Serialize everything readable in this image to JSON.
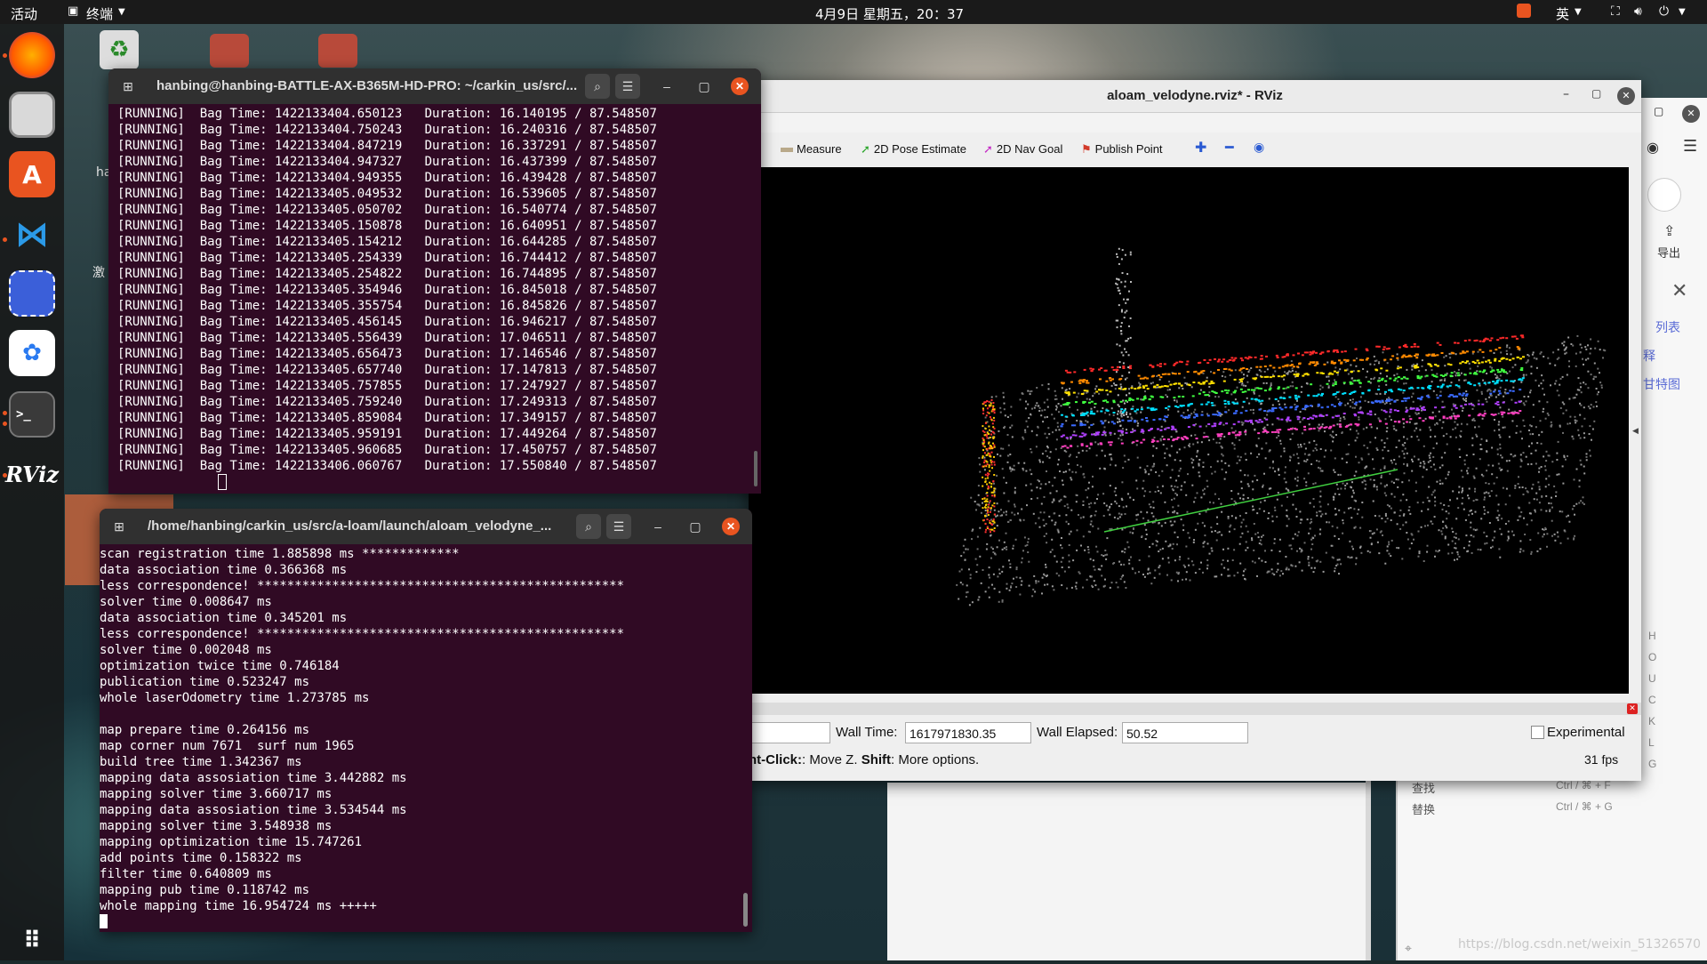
{
  "topbar": {
    "activities": "活动",
    "app_menu": "终端",
    "clock": "4月9日 星期五，20：37",
    "input_method": "英"
  },
  "desktop": {
    "icon_labels": [
      "ha",
      "激"
    ]
  },
  "terminal1": {
    "title": "hanbing@hanbing-BATTLE-AX-B365M-HD-PRO: ~/carkin_us/src/...",
    "lines": [
      "[RUNNING]  Bag Time: 1422133404.650123   Duration: 16.140195 / 87.548507",
      "[RUNNING]  Bag Time: 1422133404.750243   Duration: 16.240316 / 87.548507",
      "[RUNNING]  Bag Time: 1422133404.847219   Duration: 16.337291 / 87.548507",
      "[RUNNING]  Bag Time: 1422133404.947327   Duration: 16.437399 / 87.548507",
      "[RUNNING]  Bag Time: 1422133404.949355   Duration: 16.439428 / 87.548507",
      "[RUNNING]  Bag Time: 1422133405.049532   Duration: 16.539605 / 87.548507",
      "[RUNNING]  Bag Time: 1422133405.050702   Duration: 16.540774 / 87.548507",
      "[RUNNING]  Bag Time: 1422133405.150878   Duration: 16.640951 / 87.548507",
      "[RUNNING]  Bag Time: 1422133405.154212   Duration: 16.644285 / 87.548507",
      "[RUNNING]  Bag Time: 1422133405.254339   Duration: 16.744412 / 87.548507",
      "[RUNNING]  Bag Time: 1422133405.254822   Duration: 16.744895 / 87.548507",
      "[RUNNING]  Bag Time: 1422133405.354946   Duration: 16.845018 / 87.548507",
      "[RUNNING]  Bag Time: 1422133405.355754   Duration: 16.845826 / 87.548507",
      "[RUNNING]  Bag Time: 1422133405.456145   Duration: 16.946217 / 87.548507",
      "[RUNNING]  Bag Time: 1422133405.556439   Duration: 17.046511 / 87.548507",
      "[RUNNING]  Bag Time: 1422133405.656473   Duration: 17.146546 / 87.548507",
      "[RUNNING]  Bag Time: 1422133405.657740   Duration: 17.147813 / 87.548507",
      "[RUNNING]  Bag Time: 1422133405.757855   Duration: 17.247927 / 87.548507",
      "[RUNNING]  Bag Time: 1422133405.759240   Duration: 17.249313 / 87.548507",
      "[RUNNING]  Bag Time: 1422133405.859084   Duration: 17.349157 / 87.548507",
      "[RUNNING]  Bag Time: 1422133405.959191   Duration: 17.449264 / 87.548507",
      "[RUNNING]  Bag Time: 1422133405.960685   Duration: 17.450757 / 87.548507",
      "[RUNNING]  Bag Time: 1422133406.060767   Duration: 17.550840 / 87.548507"
    ]
  },
  "terminal2": {
    "title": "/home/hanbing/carkin_us/src/a-loam/launch/aloam_velodyne_...",
    "lines": [
      "scan registration time 1.885898 ms *************",
      "data association time 0.366368 ms",
      "less correspondence! *************************************************",
      "solver time 0.008647 ms",
      "data association time 0.345201 ms",
      "less correspondence! *************************************************",
      "solver time 0.002048 ms",
      "optimization twice time 0.746184",
      "publication time 0.523247 ms",
      "whole laserOdometry time 1.273785 ms",
      "",
      "map prepare time 0.264156 ms",
      "map corner num 7671  surf num 1965",
      "build tree time 1.342367 ms",
      "mapping data assosiation time 3.442882 ms",
      "mapping solver time 3.660717 ms",
      "mapping data assosiation time 3.534544 ms",
      "mapping solver time 3.548938 ms",
      "mapping optimization time 15.747261",
      "add points time 0.158322 ms",
      "filter time 0.640809 ms",
      "mapping pub time 0.118742 ms",
      "whole mapping time 16.954724 ms +++++"
    ]
  },
  "rviz": {
    "title": "aloam_velodyne.rviz* - RViz",
    "tools": {
      "measure": "Measure",
      "pose_estimate": "2D Pose Estimate",
      "nav_goal": "2D Nav Goal",
      "publish_point": "Publish Point"
    },
    "time": {
      "wall_time_label": "Wall Time:",
      "wall_time_value": "1617971830.35",
      "wall_elapsed_label": "Wall Elapsed:",
      "wall_elapsed_value": "50.52",
      "experimental_label": "Experimental",
      "hint_bold1": "ht-Click:",
      "hint_text1": ": Move Z. ",
      "hint_bold2": "Shift",
      "hint_text2": ": More options.",
      "fps": "31 fps"
    }
  },
  "right_app": {
    "export_label": "导出",
    "menu_list": "列表",
    "menu_annotate": "释",
    "menu_gantt": "甘特图",
    "shortcut_keys": [
      "H",
      "O",
      "U",
      "C",
      "K",
      "L",
      "G"
    ],
    "find_label": "查找",
    "find_shortcut": "Ctrl / ⌘ + F",
    "replace_label": "替换",
    "replace_shortcut": "Ctrl / ⌘ + G"
  },
  "watermark": "https://blog.csdn.net/weixin_51326570"
}
